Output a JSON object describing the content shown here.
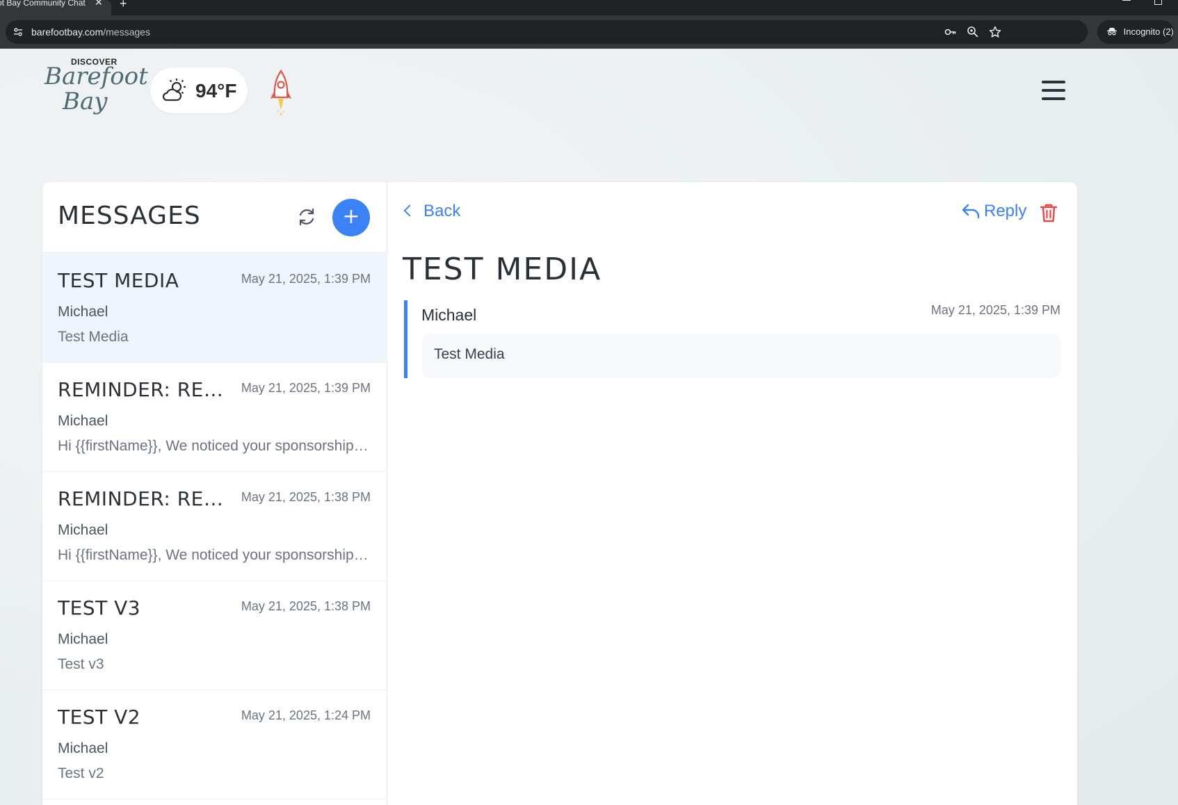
{
  "browser": {
    "tab_title": "ot Bay Community Chat",
    "tab_close": "✕",
    "new_tab": "+",
    "url_host": "barefootbay.com",
    "url_path": "/messages",
    "incognito_label": "Incognito (2)"
  },
  "header": {
    "logo_top": "DISCOVER",
    "logo_line1": "Barefoot",
    "logo_line2": "Bay",
    "weather_temp": "94°F"
  },
  "messages_panel": {
    "title": "MESSAGES",
    "compose_label": "+",
    "items": [
      {
        "subject": "TEST MEDIA",
        "date": "May 21, 2025, 1:39 PM",
        "from": "Michael",
        "preview": "Test Media",
        "active": true
      },
      {
        "subject": "REMINDER: RENEW",
        "date": "May 21, 2025, 1:39 PM",
        "from": "Michael",
        "preview": "Hi {{firstName}}, We noticed your sponsorship is about to expire",
        "active": false
      },
      {
        "subject": "REMINDER: RENEW",
        "date": "May 21, 2025, 1:38 PM",
        "from": "Michael",
        "preview": "Hi {{firstName}}, We noticed your sponsorship is about to expire",
        "active": false
      },
      {
        "subject": "TEST V3",
        "date": "May 21, 2025, 1:38 PM",
        "from": "Michael",
        "preview": "Test v3",
        "active": false
      },
      {
        "subject": "TEST V2",
        "date": "May 21, 2025, 1:24 PM",
        "from": "Michael",
        "preview": "Test v2",
        "active": false
      }
    ]
  },
  "detail": {
    "back_label": "Back",
    "reply_label": "Reply",
    "title": "TEST MEDIA",
    "from": "Michael",
    "date": "May 21, 2025, 1:39 PM",
    "body": "Test Media"
  },
  "colors": {
    "accent": "#3b82f6",
    "danger": "#ef4444",
    "active_row": "#eef5fd"
  }
}
